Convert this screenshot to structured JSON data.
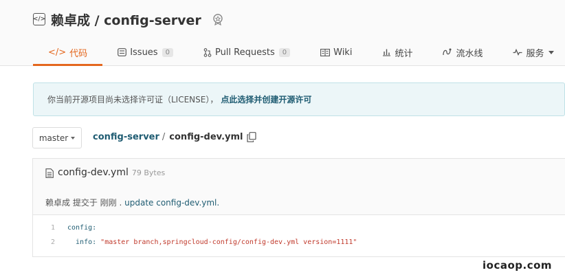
{
  "repo": {
    "owner": "赖卓成",
    "separator": "/",
    "name": "config-server",
    "title": "赖卓成 / config-server"
  },
  "tabs": [
    {
      "label": "代码",
      "icon": "code-icon",
      "active": true
    },
    {
      "label": "Issues",
      "icon": "issues-icon",
      "count": "0"
    },
    {
      "label": "Pull Requests",
      "icon": "pull-request-icon",
      "count": "0"
    },
    {
      "label": "Wiki",
      "icon": "wiki-icon"
    },
    {
      "label": "统计",
      "icon": "stats-icon"
    },
    {
      "label": "流水线",
      "icon": "pipeline-icon"
    },
    {
      "label": "服务",
      "icon": "service-icon"
    }
  ],
  "notice": {
    "text": "你当前开源项目尚未选择许可证（LICENSE），",
    "link": "点此选择并创建开源许可"
  },
  "branch": {
    "label": "master"
  },
  "breadcrumb": {
    "repo": "config-server",
    "separator": "/",
    "file": "config-dev.yml"
  },
  "file": {
    "name": "config-dev.yml",
    "size": "79 Bytes",
    "commit": {
      "author": "赖卓成",
      "action": " 提交于 ",
      "time": "刚刚",
      "dot": " . ",
      "message": "update config-dev.yml."
    },
    "lines": [
      {
        "num": "1",
        "key": "config:",
        "value": ""
      },
      {
        "num": "2",
        "key": "  info: ",
        "value": "\"master branch,springcloud-config/config-dev.yml version=1111\""
      }
    ]
  },
  "watermark": "iocaop.com",
  "colors": {
    "accent": "#e4671e",
    "link": "#1f5c72",
    "notice_bg": "#ecf6f8",
    "string": "#c0392b"
  }
}
